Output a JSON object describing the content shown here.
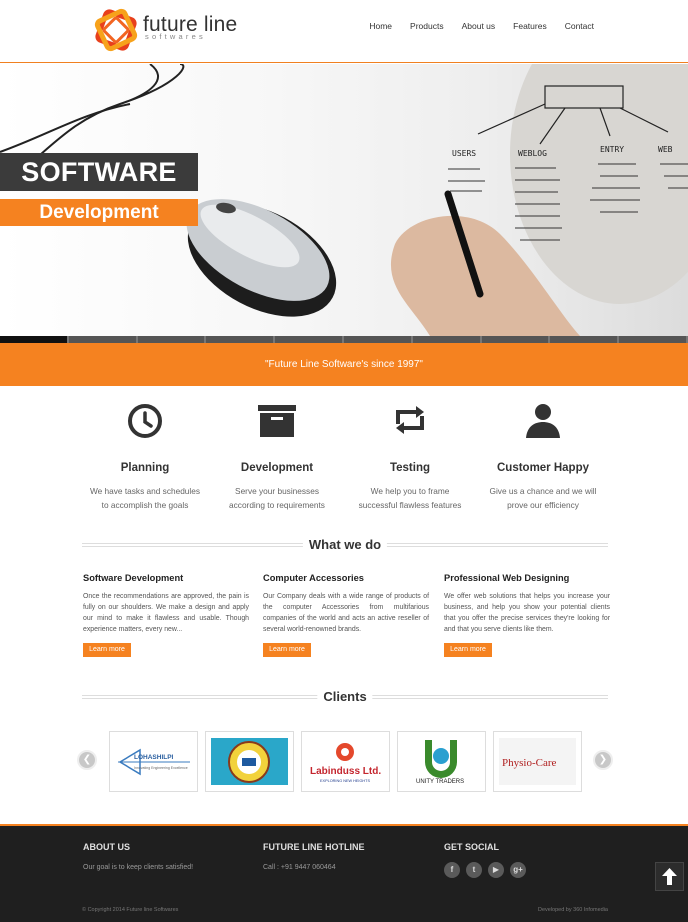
{
  "header": {
    "logo_text": "future line",
    "logo_sub": "softwares",
    "nav": [
      "Home",
      "Products",
      "About us",
      "Features",
      "Contact"
    ]
  },
  "hero": {
    "title_line1": "SOFTWARE",
    "title_line2": "Development",
    "slides_total": 10,
    "slide_active": 1
  },
  "banner": {
    "text": "\"Future Line Software's since 1997\""
  },
  "features": [
    {
      "icon": "clock-icon",
      "title": "Planning",
      "line1": "We have tasks and schedules",
      "line2": "to accomplish the goals"
    },
    {
      "icon": "archive-box-icon",
      "title": "Development",
      "line1": "Serve your businesses",
      "line2": "according to requirements"
    },
    {
      "icon": "retweet-arrows-icon",
      "title": "Testing",
      "line1": "We help you to frame",
      "line2": "successful flawless features"
    },
    {
      "icon": "user-icon",
      "title": "Customer Happy",
      "line1": "Give us a chance and we will",
      "line2": "prove our efficiency"
    }
  ],
  "what_we_do": {
    "title": "What we do",
    "columns": [
      {
        "title": "Software Development",
        "text": "Once the recommendations are approved, the pain is fully on our shoulders. We make a design and apply our mind to make it flawless and usable. Though experience matters, every new...",
        "button": "Learn more"
      },
      {
        "title": "Computer Accessories",
        "text": "Our Company deals with a wide range of products of the computer Accessories from multifarious companies of the world and acts an active reseller of several world-renowned brands.",
        "button": "Learn more"
      },
      {
        "title": "Professional Web Designing",
        "text": "We offer web solutions that helps you increase your business, and help you show your potential clients that you offer the precise services they're looking for and that you serve clients like them.",
        "button": "Learn more"
      }
    ]
  },
  "clients": {
    "title": "Clients",
    "logos": [
      "LOHASHILPI",
      "",
      "Labinduss Ltd.",
      "UNITY TRADERS",
      "Physio-Care"
    ],
    "lohashilpi_tagline": "Innovating Engineering Excellence",
    "labinduss_tagline": "EXPLORING NEW HEIGHTS"
  },
  "footer": {
    "about_title": "ABOUT US",
    "about_text": "Our goal is to keep clients satisfied!",
    "hotline_title": "FUTURE LINE HOTLINE",
    "hotline_text": "Call : +91 9447 060464",
    "social_title": "GET SOCIAL",
    "copyright": "© Copyright 2014 Future line Softwares",
    "developed_by": "Developed by 360 Infomedia"
  },
  "colors": {
    "accent": "#f58220",
    "dark": "#3b3b3b",
    "footer_bg": "#1f1f1f"
  }
}
